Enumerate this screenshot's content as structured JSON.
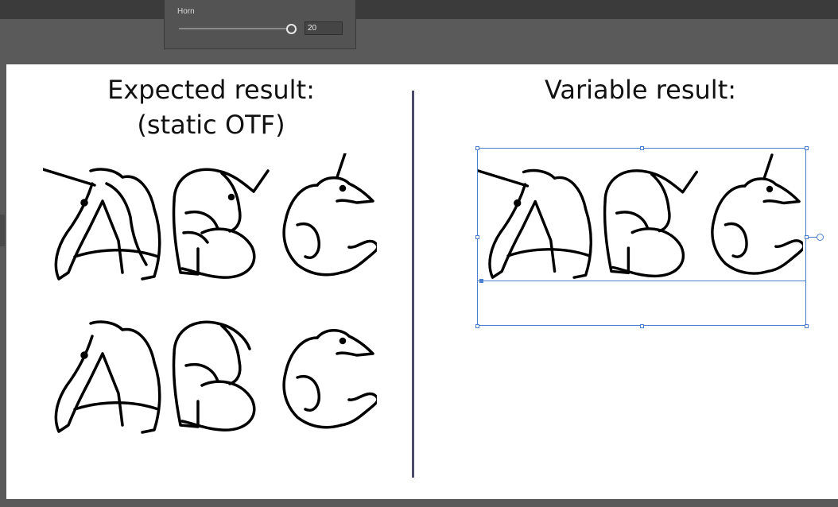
{
  "panel": {
    "label": "Horn",
    "value": "20",
    "slider_fraction": 1.0
  },
  "canvas": {
    "left_heading_line1": "Expected result:",
    "left_heading_line2": "(static OTF)",
    "right_heading": "Variable result:",
    "glyph_rows": [
      {
        "id": "expected-row-horned",
        "text": "ABC",
        "horned": true
      },
      {
        "id": "expected-row-plain",
        "text": "ABC",
        "horned": false
      },
      {
        "id": "variable-row",
        "text": "ABC",
        "horned": true
      }
    ]
  },
  "colors": {
    "selection": "#4a7fd0",
    "divider": "#4a4a6a",
    "panel": "#535353",
    "workspace": "#5a5a5a"
  }
}
